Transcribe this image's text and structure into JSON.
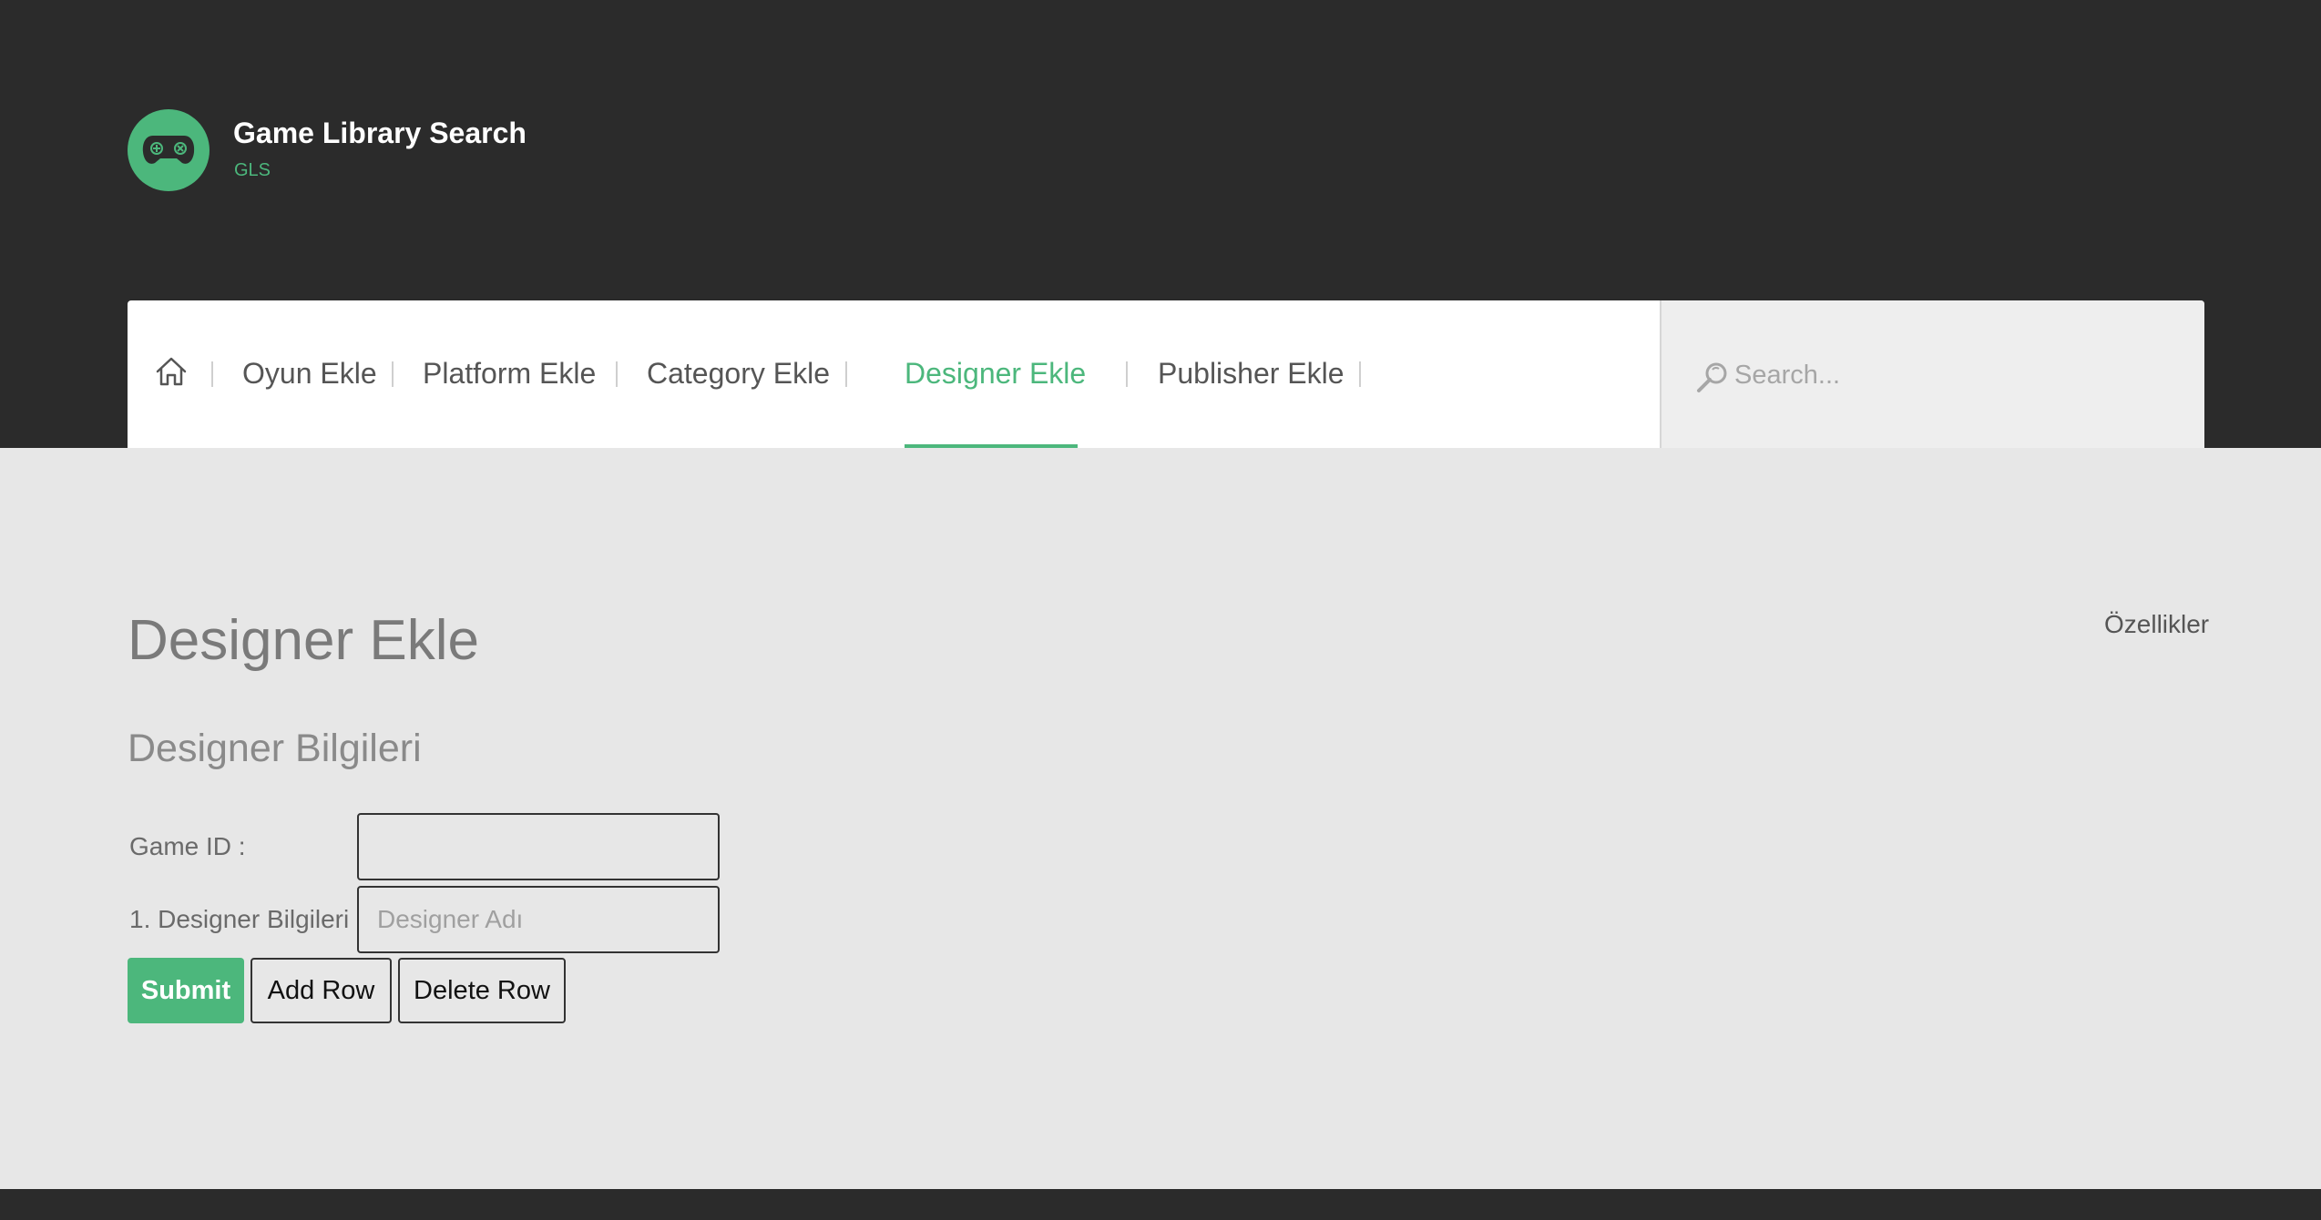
{
  "brand": {
    "title": "Game Library Search",
    "subtitle": "GLS",
    "logo_icon": "gamepad-icon",
    "accent_color": "#4cb77c"
  },
  "nav": {
    "home_icon": "home-icon",
    "items": [
      {
        "label": "Oyun Ekle",
        "active": false
      },
      {
        "label": "Platform Ekle",
        "active": false
      },
      {
        "label": "Category Ekle",
        "active": false
      },
      {
        "label": "Designer Ekle",
        "active": true
      },
      {
        "label": "Publisher Ekle",
        "active": false
      }
    ]
  },
  "search": {
    "placeholder": "Search...",
    "icon": "search-icon"
  },
  "page": {
    "title": "Designer Ekle",
    "features_link": "Özellikler",
    "section_title": "Designer Bilgileri"
  },
  "form": {
    "game_id_label": "Game ID :",
    "game_id_value": "",
    "designer_label": "1. Designer Bilgileri :",
    "designer_placeholder": "Designer Adı",
    "designer_value": ""
  },
  "buttons": {
    "submit": "Submit",
    "add_row": "Add Row",
    "delete_row": "Delete Row"
  }
}
